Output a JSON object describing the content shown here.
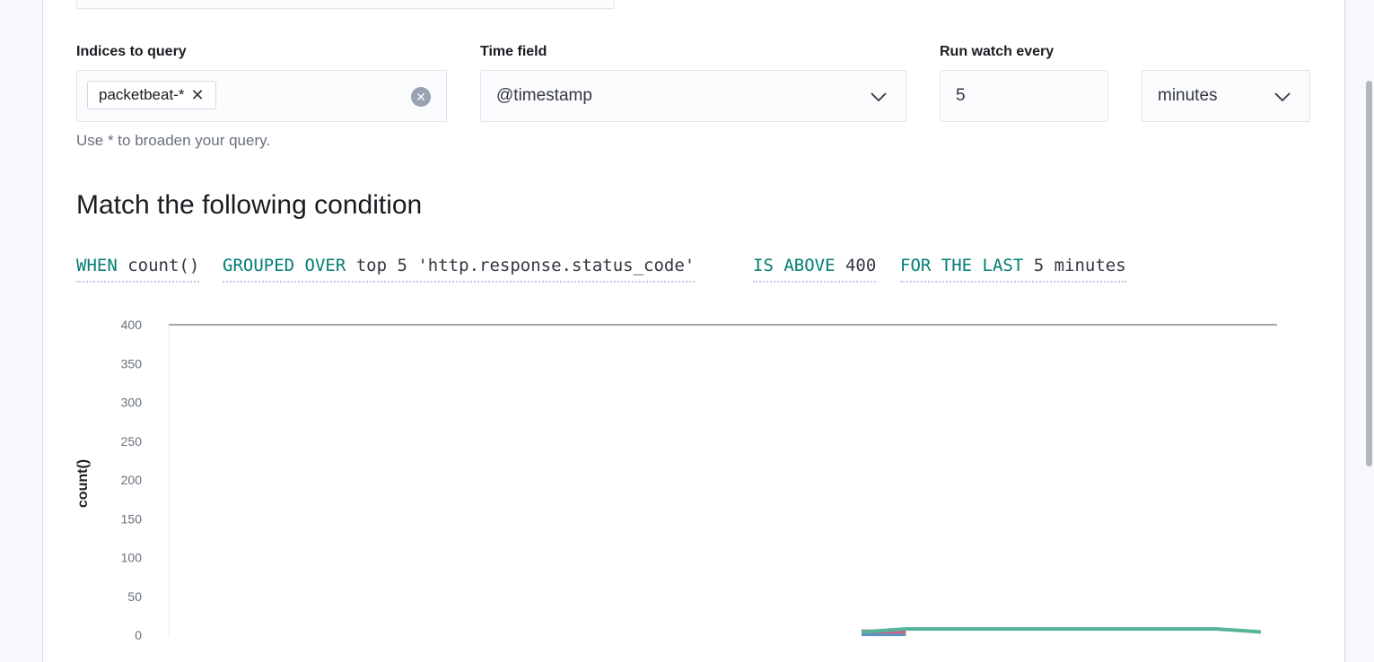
{
  "form": {
    "indices": {
      "label": "Indices to query",
      "tag": "packetbeat-*",
      "help": "Use * to broaden your query."
    },
    "time_field": {
      "label": "Time field",
      "value": "@timestamp"
    },
    "run_every": {
      "label": "Run watch every",
      "value": "5",
      "unit": "minutes"
    }
  },
  "condition": {
    "heading": "Match the following condition",
    "expression": [
      {
        "keyword": "WHEN",
        "value": "count()"
      },
      {
        "keyword": "GROUPED OVER",
        "value": "top 5 'http.response.status_code'"
      },
      {
        "keyword": "IS ABOVE",
        "value": "400"
      },
      {
        "keyword": "FOR THE LAST",
        "value": "5 minutes"
      }
    ]
  },
  "chart_data": {
    "type": "line",
    "ylabel": "count()",
    "ylim": [
      0,
      400
    ],
    "yticks": [
      0,
      50,
      100,
      150,
      200,
      250,
      300,
      350,
      400
    ],
    "threshold": 400,
    "x": [
      0,
      1,
      2,
      3,
      4,
      5,
      6,
      7,
      8,
      9,
      10,
      11,
      12,
      13,
      14,
      15,
      16,
      17,
      18,
      19,
      20,
      21,
      22,
      23,
      24
    ],
    "series": [
      {
        "color": "#54b399",
        "values": [
          null,
          null,
          null,
          null,
          null,
          null,
          null,
          null,
          null,
          null,
          null,
          null,
          null,
          null,
          null,
          4,
          8,
          8,
          8,
          8,
          8,
          8,
          8,
          8,
          4
        ]
      },
      {
        "color": "#d36086",
        "values": [
          null,
          null,
          null,
          null,
          null,
          null,
          null,
          null,
          null,
          null,
          null,
          null,
          null,
          null,
          null,
          5,
          4,
          null,
          null,
          null,
          null,
          null,
          null,
          null,
          null
        ]
      },
      {
        "color": "#6092c0",
        "values": [
          null,
          null,
          null,
          null,
          null,
          null,
          null,
          null,
          null,
          null,
          null,
          null,
          null,
          null,
          null,
          1,
          1,
          null,
          null,
          null,
          null,
          null,
          null,
          null,
          null
        ]
      }
    ]
  }
}
